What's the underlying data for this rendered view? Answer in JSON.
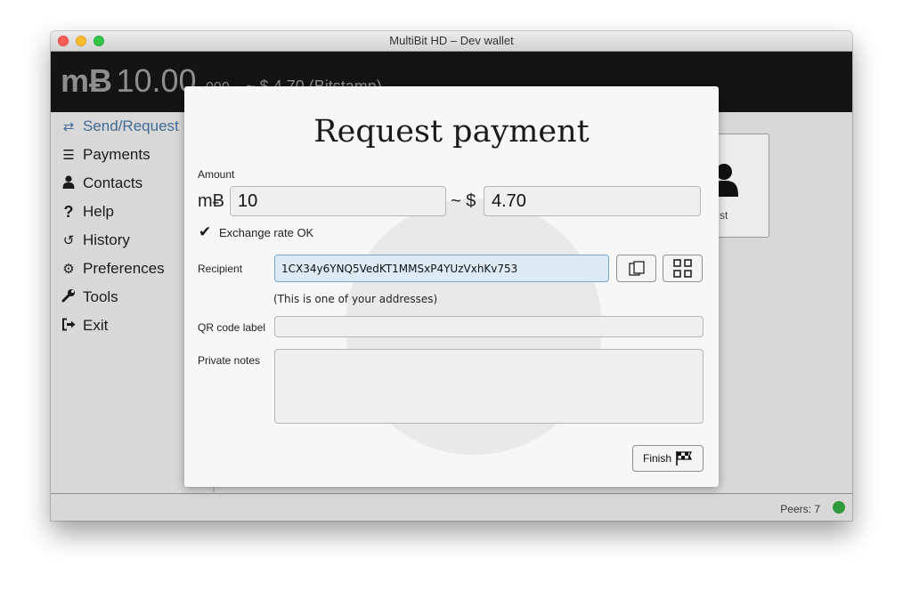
{
  "window": {
    "title": "MultiBit HD – Dev wallet"
  },
  "header": {
    "currency_symbol": "mɃ",
    "balance_main": "10.00",
    "balance_fraction": "000",
    "fiat_conversion": "~ $ 4.70 (Bitstamp)"
  },
  "sidebar": {
    "items": [
      {
        "label": "Send/Request",
        "icon": "arrows-exchange-icon",
        "active": true
      },
      {
        "label": "Payments",
        "icon": "list-icon"
      },
      {
        "label": "Contacts",
        "icon": "user-icon"
      },
      {
        "label": "Help",
        "icon": "question-icon"
      },
      {
        "label": "History",
        "icon": "history-icon"
      },
      {
        "label": "Preferences",
        "icon": "gears-icon"
      },
      {
        "label": "Tools",
        "icon": "wrench-icon"
      },
      {
        "label": "Exit",
        "icon": "sign-out-icon"
      }
    ]
  },
  "background_card": {
    "label_fragment": "st"
  },
  "dialog": {
    "title": "Request payment",
    "amount_label": "Amount",
    "currency_symbol": "mɃ",
    "amount_value": "10",
    "fiat_symbol": "~ $",
    "fiat_value": "4.70",
    "exchange_status": "Exchange rate OK",
    "recipient_label": "Recipient",
    "recipient_address": "1CX34y6YNQ5VedKT1MMSxP4YUzVxhKv753",
    "address_note": "(This is one of your addresses)",
    "qr_label": "QR code label",
    "qr_value": "",
    "notes_label": "Private notes",
    "notes_value": "",
    "finish_label": "Finish"
  },
  "status": {
    "peers": "Peers: 7",
    "peers_color": "#2f9b3a"
  },
  "colors": {
    "accent_active": "#3f6b96",
    "header_bg": "#141414"
  }
}
